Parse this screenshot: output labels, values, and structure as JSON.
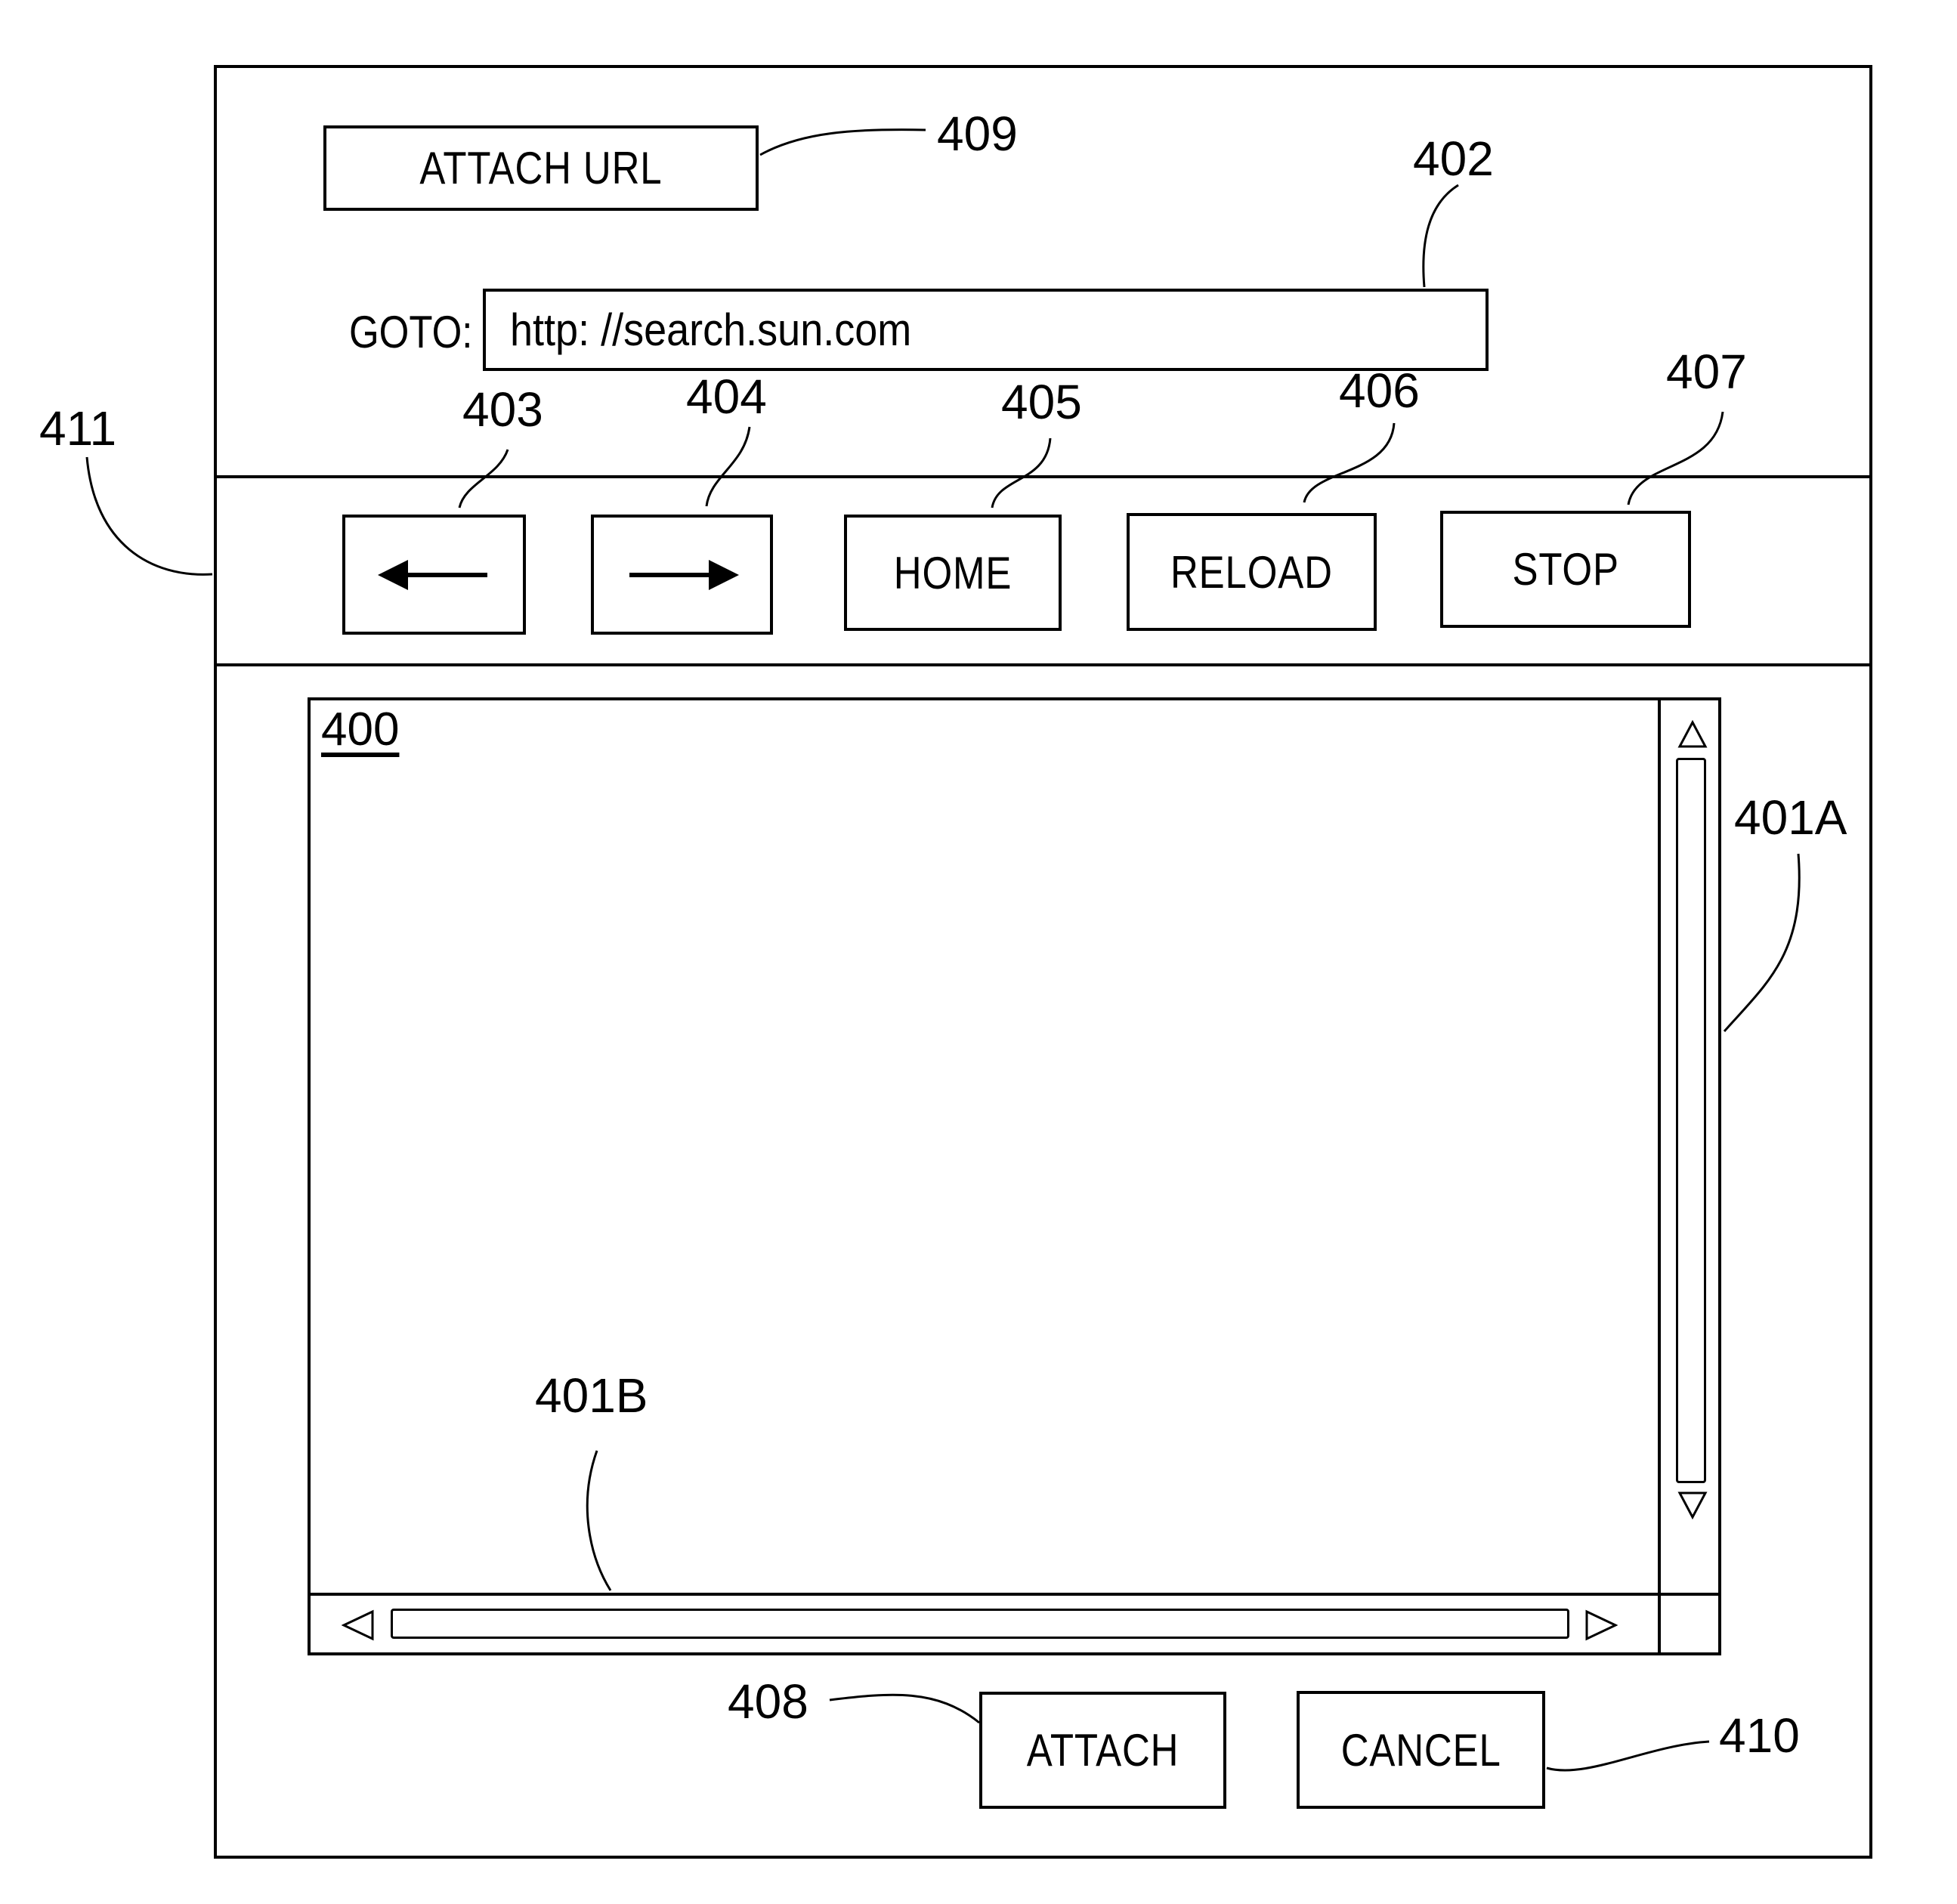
{
  "dialog": {
    "attach_url_label": "ATTACH URL",
    "goto_label": "GOTO:",
    "url_value": "http: //search.sun.com",
    "nav": {
      "back_icon": "left-arrow-icon",
      "forward_icon": "right-arrow-icon",
      "home_label": "HOME",
      "reload_label": "RELOAD",
      "stop_label": "STOP"
    },
    "content_ref": "400",
    "scroll": {
      "up_icon": "triangle-up-icon",
      "down_icon": "triangle-down-icon",
      "left_icon": "triangle-left-icon",
      "right_icon": "triangle-right-icon"
    },
    "attach_label": "ATTACH",
    "cancel_label": "CANCEL"
  },
  "reference_numerals": {
    "r400": "400",
    "r401a": "401A",
    "r401b": "401B",
    "r402": "402",
    "r403": "403",
    "r404": "404",
    "r405": "405",
    "r406": "406",
    "r407": "407",
    "r408": "408",
    "r409": "409",
    "r410": "410",
    "r411": "411"
  }
}
